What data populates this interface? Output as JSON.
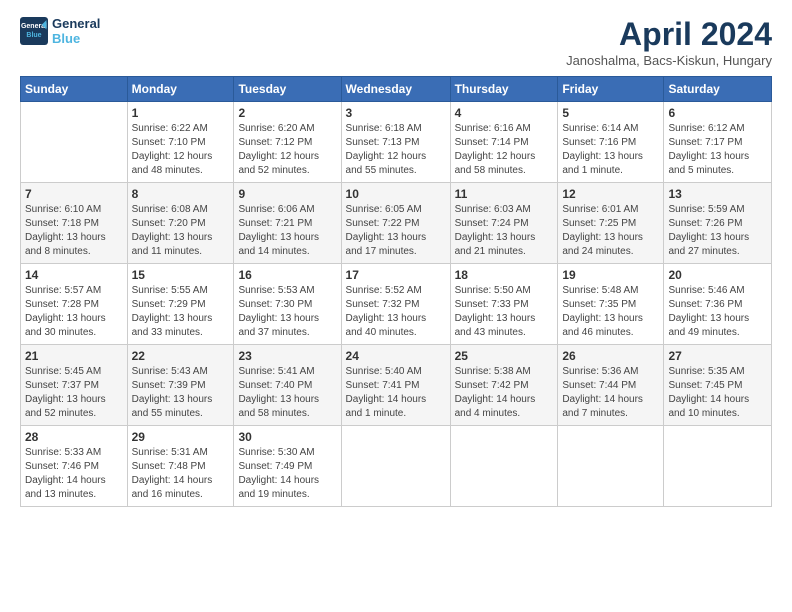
{
  "header": {
    "logo_line1": "General",
    "logo_line2": "Blue",
    "month_title": "April 2024",
    "subtitle": "Janoshalma, Bacs-Kiskun, Hungary"
  },
  "weekdays": [
    "Sunday",
    "Monday",
    "Tuesday",
    "Wednesday",
    "Thursday",
    "Friday",
    "Saturday"
  ],
  "weeks": [
    [
      {
        "day": "",
        "info": ""
      },
      {
        "day": "1",
        "info": "Sunrise: 6:22 AM\nSunset: 7:10 PM\nDaylight: 12 hours\nand 48 minutes."
      },
      {
        "day": "2",
        "info": "Sunrise: 6:20 AM\nSunset: 7:12 PM\nDaylight: 12 hours\nand 52 minutes."
      },
      {
        "day": "3",
        "info": "Sunrise: 6:18 AM\nSunset: 7:13 PM\nDaylight: 12 hours\nand 55 minutes."
      },
      {
        "day": "4",
        "info": "Sunrise: 6:16 AM\nSunset: 7:14 PM\nDaylight: 12 hours\nand 58 minutes."
      },
      {
        "day": "5",
        "info": "Sunrise: 6:14 AM\nSunset: 7:16 PM\nDaylight: 13 hours\nand 1 minute."
      },
      {
        "day": "6",
        "info": "Sunrise: 6:12 AM\nSunset: 7:17 PM\nDaylight: 13 hours\nand 5 minutes."
      }
    ],
    [
      {
        "day": "7",
        "info": "Sunrise: 6:10 AM\nSunset: 7:18 PM\nDaylight: 13 hours\nand 8 minutes."
      },
      {
        "day": "8",
        "info": "Sunrise: 6:08 AM\nSunset: 7:20 PM\nDaylight: 13 hours\nand 11 minutes."
      },
      {
        "day": "9",
        "info": "Sunrise: 6:06 AM\nSunset: 7:21 PM\nDaylight: 13 hours\nand 14 minutes."
      },
      {
        "day": "10",
        "info": "Sunrise: 6:05 AM\nSunset: 7:22 PM\nDaylight: 13 hours\nand 17 minutes."
      },
      {
        "day": "11",
        "info": "Sunrise: 6:03 AM\nSunset: 7:24 PM\nDaylight: 13 hours\nand 21 minutes."
      },
      {
        "day": "12",
        "info": "Sunrise: 6:01 AM\nSunset: 7:25 PM\nDaylight: 13 hours\nand 24 minutes."
      },
      {
        "day": "13",
        "info": "Sunrise: 5:59 AM\nSunset: 7:26 PM\nDaylight: 13 hours\nand 27 minutes."
      }
    ],
    [
      {
        "day": "14",
        "info": "Sunrise: 5:57 AM\nSunset: 7:28 PM\nDaylight: 13 hours\nand 30 minutes."
      },
      {
        "day": "15",
        "info": "Sunrise: 5:55 AM\nSunset: 7:29 PM\nDaylight: 13 hours\nand 33 minutes."
      },
      {
        "day": "16",
        "info": "Sunrise: 5:53 AM\nSunset: 7:30 PM\nDaylight: 13 hours\nand 37 minutes."
      },
      {
        "day": "17",
        "info": "Sunrise: 5:52 AM\nSunset: 7:32 PM\nDaylight: 13 hours\nand 40 minutes."
      },
      {
        "day": "18",
        "info": "Sunrise: 5:50 AM\nSunset: 7:33 PM\nDaylight: 13 hours\nand 43 minutes."
      },
      {
        "day": "19",
        "info": "Sunrise: 5:48 AM\nSunset: 7:35 PM\nDaylight: 13 hours\nand 46 minutes."
      },
      {
        "day": "20",
        "info": "Sunrise: 5:46 AM\nSunset: 7:36 PM\nDaylight: 13 hours\nand 49 minutes."
      }
    ],
    [
      {
        "day": "21",
        "info": "Sunrise: 5:45 AM\nSunset: 7:37 PM\nDaylight: 13 hours\nand 52 minutes."
      },
      {
        "day": "22",
        "info": "Sunrise: 5:43 AM\nSunset: 7:39 PM\nDaylight: 13 hours\nand 55 minutes."
      },
      {
        "day": "23",
        "info": "Sunrise: 5:41 AM\nSunset: 7:40 PM\nDaylight: 13 hours\nand 58 minutes."
      },
      {
        "day": "24",
        "info": "Sunrise: 5:40 AM\nSunset: 7:41 PM\nDaylight: 14 hours\nand 1 minute."
      },
      {
        "day": "25",
        "info": "Sunrise: 5:38 AM\nSunset: 7:42 PM\nDaylight: 14 hours\nand 4 minutes."
      },
      {
        "day": "26",
        "info": "Sunrise: 5:36 AM\nSunset: 7:44 PM\nDaylight: 14 hours\nand 7 minutes."
      },
      {
        "day": "27",
        "info": "Sunrise: 5:35 AM\nSunset: 7:45 PM\nDaylight: 14 hours\nand 10 minutes."
      }
    ],
    [
      {
        "day": "28",
        "info": "Sunrise: 5:33 AM\nSunset: 7:46 PM\nDaylight: 14 hours\nand 13 minutes."
      },
      {
        "day": "29",
        "info": "Sunrise: 5:31 AM\nSunset: 7:48 PM\nDaylight: 14 hours\nand 16 minutes."
      },
      {
        "day": "30",
        "info": "Sunrise: 5:30 AM\nSunset: 7:49 PM\nDaylight: 14 hours\nand 19 minutes."
      },
      {
        "day": "",
        "info": ""
      },
      {
        "day": "",
        "info": ""
      },
      {
        "day": "",
        "info": ""
      },
      {
        "day": "",
        "info": ""
      }
    ]
  ]
}
